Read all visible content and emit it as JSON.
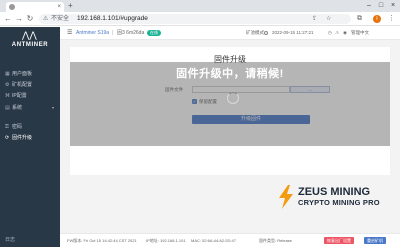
{
  "browser": {
    "tab_close": "×",
    "new_tab": "+",
    "window_minimize": "–",
    "window_maximize": "□",
    "window_close": "×",
    "back_icon": "←",
    "forward_icon": "→",
    "reload_icon": "↻",
    "security_warning": "不安全",
    "url": "192.168.1.101/#upgrade",
    "avatar_letter": "I"
  },
  "sidebar": {
    "logo_text": "ANTMINER",
    "items": [
      {
        "label": "用户面板",
        "icon": "dashboard-icon"
      },
      {
        "label": "矿机配置",
        "icon": "config-icon"
      },
      {
        "label": "IP配置",
        "icon": "network-icon"
      },
      {
        "label": "系统",
        "icon": "system-icon",
        "caret": "▾"
      },
      {
        "label": "密码",
        "icon": "lock-icon"
      },
      {
        "label": "固件升级",
        "icon": "upgrade-icon"
      }
    ],
    "footer": "日志"
  },
  "header": {
    "model": "Antminer S19a",
    "separator": "|",
    "chip": "固3 6m26da",
    "status_badge": "在线",
    "mode_label": "矿池模式",
    "datetime": "2022-09-15 11:27:21",
    "user": "管理中文"
  },
  "upgrade": {
    "title": "固件升级",
    "file_label": "固件文件",
    "browse_label": "...",
    "keep_settings": "保留配置",
    "submit_label": "升级固件"
  },
  "overlay": {
    "message": "固件升级中，请稍候!"
  },
  "watermark": {
    "line1": "ZEUS MINING",
    "line2": "CRYPTO MINING PRO"
  },
  "footer": {
    "fw_version": "FW版本: Fri Oct 15 14:42:44 CST 2021",
    "ip": "IP地址: 192.168.1.101",
    "mac": "MAC: 52:6A:44:A2:2D:47",
    "build": "固件类型: Release",
    "reset_button": "恢复出厂设置",
    "reboot_button": "重启矿机"
  },
  "colors": {
    "sidebar_bg": "#293846",
    "accent_blue": "#3c6fc9",
    "online_green": "#1ab394",
    "reset_red": "#ed5565",
    "reboot_blue": "#4a78c8",
    "watermark_orange": "#f39c12"
  }
}
